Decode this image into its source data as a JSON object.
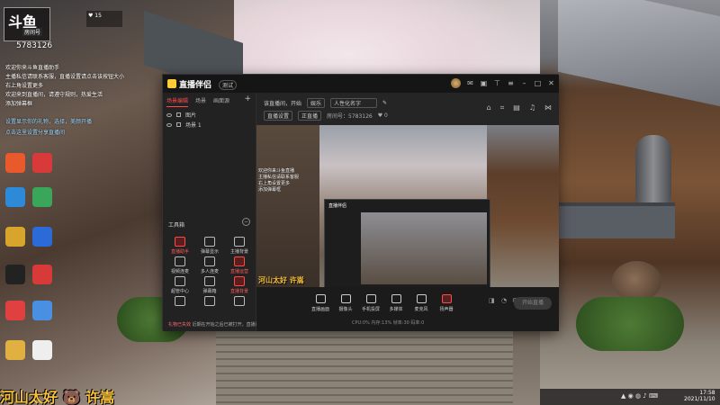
{
  "overlay": {
    "logo_text": "斗鱼",
    "room_label": "房间号",
    "room_id": "5783126",
    "likes_label": "♥ 15",
    "chat_lines": [
      "欢迎你来斗鱼直播助手",
      "主播私信请联系客服，直播设置请点击该按钮大小",
      "右上角设置更多",
      "欢迎来到直播间，请遵守规则，热爱生活",
      "添加弹幕框",
      "设置显示你的礼物，选择，美颜开播",
      "点击这里设置分享直播间"
    ]
  },
  "desktop_icons": [
    {
      "label": "",
      "color": "#e85a2c"
    },
    {
      "label": "",
      "color": "#d83a3a"
    },
    {
      "label": "",
      "color": "#2c8ad8"
    },
    {
      "label": "",
      "color": "#3aa65a"
    },
    {
      "label": "",
      "color": "#d8a52c"
    },
    {
      "label": "",
      "color": "#2c6ad8"
    },
    {
      "label": "",
      "color": "#222222"
    },
    {
      "label": "",
      "color": "#d83a3a"
    },
    {
      "label": "",
      "color": "#e04040"
    },
    {
      "label": "",
      "color": "#4a90e2"
    },
    {
      "label": "",
      "color": "#e0b040"
    },
    {
      "label": "",
      "color": "#eeeeee"
    }
  ],
  "bottom_banner": "河山太好 🐻 许嵩",
  "taskbar": {
    "time": "17:58",
    "date": "2021/11/10"
  },
  "app": {
    "name": "直播伴侣",
    "version": "测试",
    "left_panel": {
      "tabs": [
        "场景编辑",
        "场景",
        "画面源"
      ],
      "layers": [
        "图片",
        "场景 1"
      ],
      "tools_title": "工具箱",
      "tools": [
        {
          "label": "直播助手",
          "red": true
        },
        {
          "label": "弹幕显示",
          "red": false
        },
        {
          "label": "主播背景",
          "red": false
        },
        {
          "label": "视频连麦",
          "red": false
        },
        {
          "label": "多人连麦",
          "red": false
        },
        {
          "label": "直播运营",
          "red": true
        },
        {
          "label": "超管中心",
          "red": false
        },
        {
          "label": "弹幕箱",
          "red": false
        },
        {
          "label": "直播背景",
          "red": true
        },
        {
          "label": "",
          "red": false
        },
        {
          "label": "",
          "red": false
        },
        {
          "label": "",
          "red": false
        }
      ],
      "footer_warning": "礼物已失效",
      "footer_text": "近期在开始之后已被打开，直播间链接"
    },
    "topbar": {
      "title_label": "该直播间，开始",
      "category_value": "娱乐",
      "room_name": "人性化名字",
      "row2_a": "直播设置",
      "row2_b": "正直播",
      "row2_c": "房间号：5783126",
      "row2_d": "♥ 0"
    },
    "preview": {
      "inner_title": "直播伴侣",
      "overlay_text": [
        "欢迎你来斗鱼直播",
        "主播私信请联系客服",
        "右上角设置更多",
        "添加弹幕框"
      ],
      "banner": "河山太好 许嵩"
    },
    "controls": [
      {
        "label": "直播画面",
        "highlight": false
      },
      {
        "label": "摄像头",
        "highlight": false
      },
      {
        "label": "手机投屏",
        "highlight": false
      },
      {
        "label": "多媒体",
        "highlight": false
      },
      {
        "label": "麦克风",
        "highlight": false
      },
      {
        "label": "扬声器",
        "highlight": true
      }
    ],
    "start_label": "开始直播",
    "stats_text": "CPU:0%  内存:13%  帧率:30  码率:0"
  }
}
